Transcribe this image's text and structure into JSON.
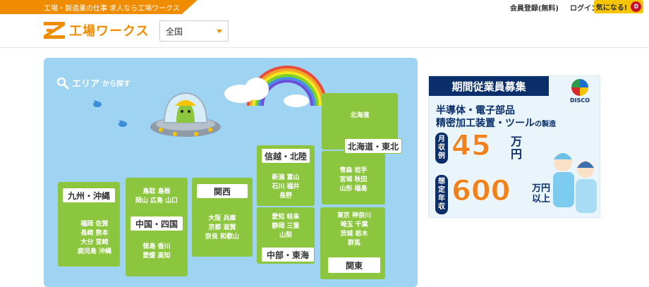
{
  "topbar": {
    "tagline": "工場・製造業の仕事 求人なら工場ワークス",
    "register_label": "会員登録(無料)",
    "login_label": "ログイン",
    "favorites_label": "気になる!",
    "favorites_count": "0"
  },
  "header": {
    "logo_text": "工場ワークス",
    "area_select_value": "全国"
  },
  "map": {
    "heading_big": "エリア",
    "heading_small": "から探す",
    "regions": [
      {
        "name": "北海道",
        "prefs": []
      },
      {
        "name": "北海道・東北",
        "prefs": [
          "青森 岩手",
          "宮城 秋田",
          "山形 福島"
        ]
      },
      {
        "name": "信越・北陸",
        "prefs": [
          "新潟 富山",
          "石川 福井",
          "長野"
        ]
      },
      {
        "name": "関西",
        "prefs": [
          "大阪 兵庫",
          "京都 滋賀",
          "奈良 和歌山"
        ]
      },
      {
        "name": "中国・四国",
        "prefs_top": [
          "鳥取 島根",
          "岡山 広島 山口"
        ],
        "prefs_bottom": [
          "徳島 香川",
          "愛媛 高知"
        ]
      },
      {
        "name": "九州・沖縄",
        "prefs": [
          "福岡 佐賀",
          "長崎 熊本",
          "大分 宮崎",
          "鹿児島 沖縄"
        ]
      },
      {
        "name": "中部・東海",
        "prefs": [
          "愛知 岐阜",
          "静岡 三重",
          "山梨"
        ]
      },
      {
        "name": "関東",
        "prefs": [
          "東京 神奈川",
          "埼玉 千葉",
          "茨城 栃木",
          "群馬"
        ]
      }
    ]
  },
  "ad": {
    "title": "期間従業員募集",
    "brand": "DISCO",
    "line1": "半導体・電子部品",
    "line2_main": "精密加工装置・ツール",
    "line2_small": "の製造",
    "tag_monthly": "月収例",
    "amount_monthly": "45",
    "unit_monthly": "万円",
    "tag_annual": "想定年収",
    "amount_annual": "600",
    "unit_annual": "万円以上"
  },
  "colors": {
    "brand_orange": "#f08c00",
    "map_sky": "#9ed3f2",
    "region_green": "#8cc63f",
    "ad_navy": "#0b2f6b"
  }
}
